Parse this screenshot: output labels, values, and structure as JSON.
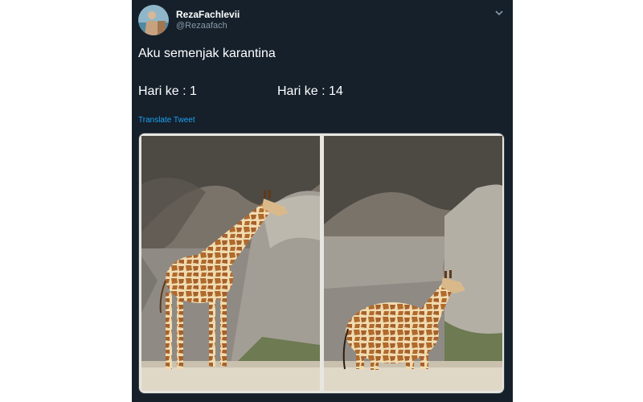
{
  "tweet": {
    "author_name": "RezaFachlevii",
    "author_handle": "@Rezaafach",
    "text": "Aku semenjak karantina",
    "day_left": "Hari ke : 1",
    "day_right": "Hari ke : 14",
    "translate_label": "Translate Tweet"
  },
  "icons": {
    "menu": "chevron-down-icon",
    "avatar": "profile-photo"
  },
  "colors": {
    "background": "#15202b",
    "secondary_text": "#8899a6",
    "link": "#1da1f2",
    "page": "#ffffff"
  }
}
